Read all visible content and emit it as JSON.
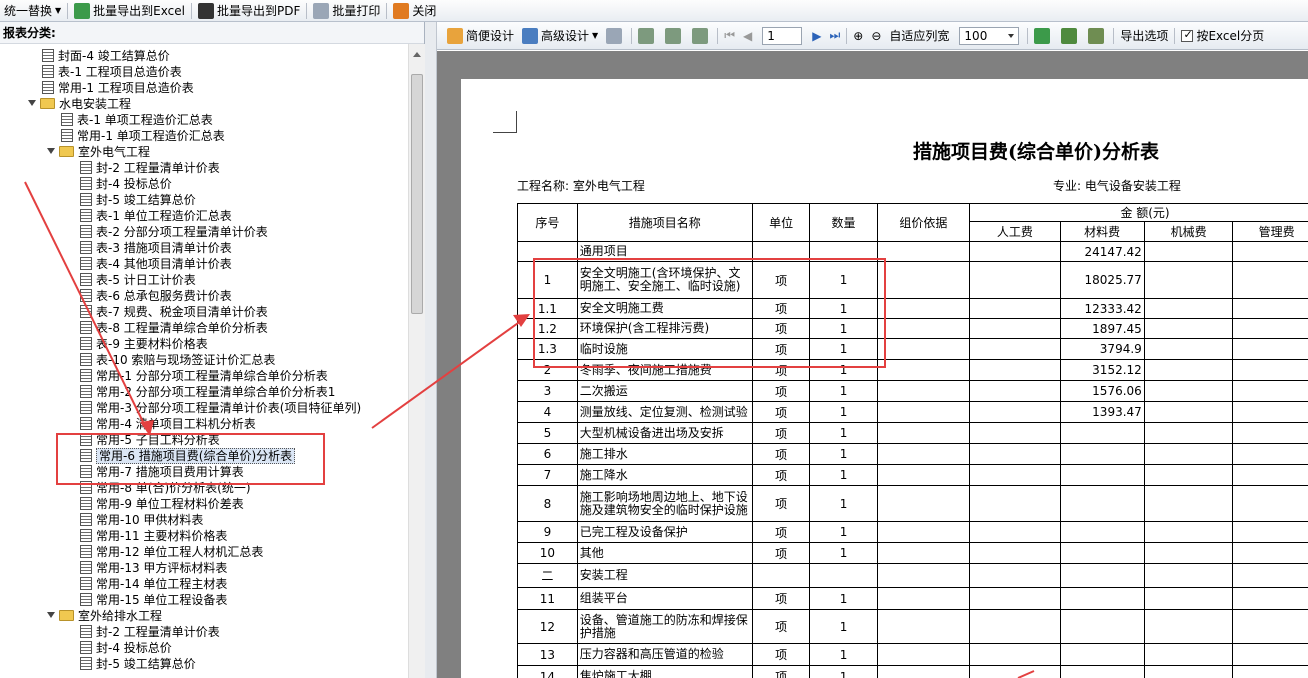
{
  "toolbar": {
    "items": [
      {
        "label": "统一替换",
        "icon": "replace-icon",
        "dropdown": true
      },
      {
        "label": "批量导出到Excel",
        "icon": "excel-export-icon"
      },
      {
        "label": "批量导出到PDF",
        "icon": "pdf-export-icon"
      },
      {
        "label": "批量打印",
        "icon": "printer-icon"
      },
      {
        "label": "关闭",
        "icon": "close-icon"
      }
    ]
  },
  "sidebar": {
    "title": "报表分类:"
  },
  "tree": [
    {
      "label": "封面-4 竣工结算总价",
      "depth": 1,
      "type": "doc"
    },
    {
      "label": "表-1 工程项目总造价表",
      "depth": 1,
      "type": "doc"
    },
    {
      "label": "常用-1 工程项目总造价表",
      "depth": 1,
      "type": "doc"
    },
    {
      "label": "水电安装工程",
      "depth": 1,
      "type": "folder"
    },
    {
      "label": "表-1 单项工程造价汇总表",
      "depth": 2,
      "type": "doc"
    },
    {
      "label": "常用-1 单项工程造价汇总表",
      "depth": 2,
      "type": "doc"
    },
    {
      "label": "室外电气工程",
      "depth": 2,
      "type": "folder"
    },
    {
      "label": "封-2 工程量清单计价表",
      "depth": 3,
      "type": "doc"
    },
    {
      "label": "封-4 投标总价",
      "depth": 3,
      "type": "doc"
    },
    {
      "label": "封-5 竣工结算总价",
      "depth": 3,
      "type": "doc"
    },
    {
      "label": "表-1 单位工程造价汇总表",
      "depth": 3,
      "type": "doc"
    },
    {
      "label": "表-2 分部分项工程量清单计价表",
      "depth": 3,
      "type": "doc"
    },
    {
      "label": "表-3 措施项目清单计价表",
      "depth": 3,
      "type": "doc"
    },
    {
      "label": "表-4 其他项目清单计价表",
      "depth": 3,
      "type": "doc"
    },
    {
      "label": "表-5 计日工计价表",
      "depth": 3,
      "type": "doc"
    },
    {
      "label": "表-6 总承包服务费计价表",
      "depth": 3,
      "type": "doc"
    },
    {
      "label": "表-7 规费、税金项目清单计价表",
      "depth": 3,
      "type": "doc"
    },
    {
      "label": "表-8 工程量清单综合单价分析表",
      "depth": 3,
      "type": "doc"
    },
    {
      "label": "表-9 主要材料价格表",
      "depth": 3,
      "type": "doc"
    },
    {
      "label": "表-10 索赔与现场签证计价汇总表",
      "depth": 3,
      "type": "doc"
    },
    {
      "label": "常用-1 分部分项工程量清单综合单价分析表",
      "depth": 3,
      "type": "doc"
    },
    {
      "label": "常用-2 分部分项工程量清单综合单价分析表1",
      "depth": 3,
      "type": "doc"
    },
    {
      "label": "常用-3 分部分项工程量清单计价表(项目特征单列)",
      "depth": 3,
      "type": "doc"
    },
    {
      "label": "常用-4 清单项目工料机分析表",
      "depth": 3,
      "type": "doc"
    },
    {
      "label": "常用-5 子目工料分析表",
      "depth": 3,
      "type": "doc"
    },
    {
      "label": "常用-6 措施项目费(综合单价)分析表",
      "depth": 3,
      "type": "doc",
      "selected": true
    },
    {
      "label": "常用-7 措施项目费用计算表",
      "depth": 3,
      "type": "doc"
    },
    {
      "label": "常用-8 单(合)价分析表(统一)",
      "depth": 3,
      "type": "doc"
    },
    {
      "label": "常用-9 单位工程材料价差表",
      "depth": 3,
      "type": "doc"
    },
    {
      "label": "常用-10 甲供材料表",
      "depth": 3,
      "type": "doc"
    },
    {
      "label": "常用-11 主要材料价格表",
      "depth": 3,
      "type": "doc"
    },
    {
      "label": "常用-12 单位工程人材机汇总表",
      "depth": 3,
      "type": "doc"
    },
    {
      "label": "常用-13 甲方评标材料表",
      "depth": 3,
      "type": "doc"
    },
    {
      "label": "常用-14 单位工程主材表",
      "depth": 3,
      "type": "doc"
    },
    {
      "label": "常用-15 单位工程设备表",
      "depth": 3,
      "type": "doc"
    },
    {
      "label": "室外给排水工程",
      "depth": 2,
      "type": "folder"
    },
    {
      "label": "封-2 工程量清单计价表",
      "depth": 3,
      "type": "doc"
    },
    {
      "label": "封-4 投标总价",
      "depth": 3,
      "type": "doc"
    },
    {
      "label": "封-5 竣工结算总价",
      "depth": 3,
      "type": "doc"
    }
  ],
  "viewer_toolbar": {
    "simple_design": "简便设计",
    "advanced_design": "高级设计",
    "page": "1",
    "fit_width": "自适应列宽",
    "zoom": "100",
    "export_options": "导出选项",
    "excel_paging": "按Excel分页"
  },
  "report": {
    "title": "措施项目费(综合单价)分析表",
    "project_name": "工程名称: 室外电气工程",
    "specialty": "专业: 电气设备安装工程",
    "headers": {
      "seq": "序号",
      "name": "措施项目名称",
      "unit": "单位",
      "qty": "数量",
      "basis": "组价依据",
      "amount": "金 额(元)",
      "labor": "人工费",
      "material": "材料费",
      "machine": "机械费",
      "mgmt": "管理费"
    },
    "rows": [
      {
        "seq": "",
        "name": "通用项目",
        "unit": "",
        "qty": "",
        "material": "24147.42",
        "h": 20
      },
      {
        "seq": "1",
        "name": "安全文明施工(含环境保护、文明施工、安全施工、临时设施)",
        "unit": "项",
        "qty": "1",
        "material": "18025.77",
        "h": 37
      },
      {
        "seq": "1.1",
        "name": "安全文明施工费",
        "unit": "项",
        "qty": "1",
        "material": "12333.42",
        "h": 20
      },
      {
        "seq": "1.2",
        "name": "环境保护(含工程排污费)",
        "unit": "项",
        "qty": "1",
        "material": "1897.45",
        "h": 20
      },
      {
        "seq": "1.3",
        "name": "临时设施",
        "unit": "项",
        "qty": "1",
        "material": "3794.9",
        "h": 21
      },
      {
        "seq": "2",
        "name": "冬雨季、夜间施工措施费",
        "unit": "项",
        "qty": "1",
        "material": "3152.12",
        "h": 21
      },
      {
        "seq": "3",
        "name": "二次搬运",
        "unit": "项",
        "qty": "1",
        "material": "1576.06",
        "h": 21
      },
      {
        "seq": "4",
        "name": "测量放线、定位复测、检测试验",
        "unit": "项",
        "qty": "1",
        "material": "1393.47",
        "h": 21
      },
      {
        "seq": "5",
        "name": "大型机械设备进出场及安拆",
        "unit": "项",
        "qty": "1",
        "material": "",
        "h": 21
      },
      {
        "seq": "6",
        "name": "施工排水",
        "unit": "项",
        "qty": "1",
        "material": "",
        "h": 21
      },
      {
        "seq": "7",
        "name": "施工降水",
        "unit": "项",
        "qty": "1",
        "material": "",
        "h": 21
      },
      {
        "seq": "8",
        "name": "施工影响场地周边地上、地下设施及建筑物安全的临时保护设施",
        "unit": "项",
        "qty": "1",
        "material": "",
        "h": 36
      },
      {
        "seq": "9",
        "name": "已完工程及设备保护",
        "unit": "项",
        "qty": "1",
        "material": "",
        "h": 21
      },
      {
        "seq": "10",
        "name": "其他",
        "unit": "项",
        "qty": "1",
        "material": "",
        "h": 21
      },
      {
        "seq": "二",
        "name": "安装工程",
        "unit": "",
        "qty": "",
        "material": "",
        "h": 24
      },
      {
        "seq": "11",
        "name": "组装平台",
        "unit": "项",
        "qty": "1",
        "material": "",
        "h": 22
      },
      {
        "seq": "12",
        "name": "设备、管道施工的防冻和焊接保护措施",
        "unit": "项",
        "qty": "1",
        "material": "",
        "h": 34
      },
      {
        "seq": "13",
        "name": "压力容器和高压管道的检验",
        "unit": "项",
        "qty": "1",
        "material": "",
        "h": 22
      },
      {
        "seq": "14",
        "name": "焦炉施工大棚",
        "unit": "项",
        "qty": "1",
        "material": "",
        "h": 22
      }
    ]
  },
  "colors": {
    "annotation": "#e34040",
    "accent": "#3a6fb5"
  }
}
